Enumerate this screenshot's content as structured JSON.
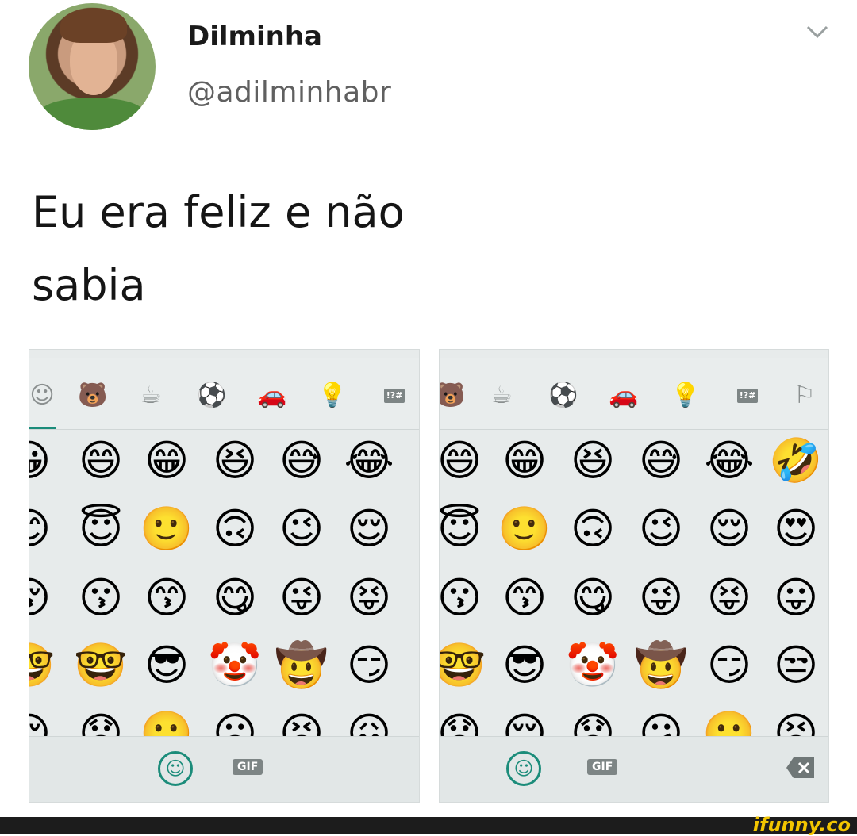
{
  "tweet": {
    "name": "Dilminha",
    "handle": "@adilminhabr",
    "text_line1": "Eu era feliz e não",
    "text_line2": "sabia"
  },
  "keyboard_left": {
    "categories": [
      "☺",
      "🐻",
      "☕",
      "⚽",
      "🚗",
      "💡",
      "!?#"
    ],
    "rows": [
      [
        "😀",
        "😄",
        "😁",
        "😆",
        "😅",
        "😂"
      ],
      [
        "😊",
        "😇",
        "🙂",
        "🙃",
        "😉",
        "😌"
      ],
      [
        "😚",
        "😗",
        "😙",
        "😋",
        "😜",
        "😝"
      ],
      [
        "🤓",
        "🤓",
        "😎",
        "🤡",
        "🤠",
        "😏"
      ],
      [
        "😔",
        "😟",
        "🙁",
        "☹",
        "😣",
        "😖"
      ]
    ],
    "gif_label": "GIF"
  },
  "keyboard_right": {
    "categories": [
      "🐻",
      "☕",
      "⚽",
      "🚗",
      "💡",
      "!?#",
      "⚐"
    ],
    "rows": [
      [
        "😄",
        "😁",
        "😆",
        "😅",
        "😂",
        "🤣"
      ],
      [
        "😇",
        "🙂",
        "🙃",
        "😉",
        "😌",
        "😍"
      ],
      [
        "😗",
        "😙",
        "😋",
        "😜",
        "😝",
        "😛"
      ],
      [
        "🤓",
        "😎",
        "🤡",
        "🤠",
        "😏",
        "😒"
      ],
      [
        "😞",
        "😔",
        "😟",
        "😕",
        "🙁",
        "😣"
      ]
    ],
    "gif_label": "GIF"
  },
  "watermark": "ifunny.co",
  "colors": {
    "accent": "#1b8c7a",
    "keyboard_bg": "#e7ebeb"
  }
}
